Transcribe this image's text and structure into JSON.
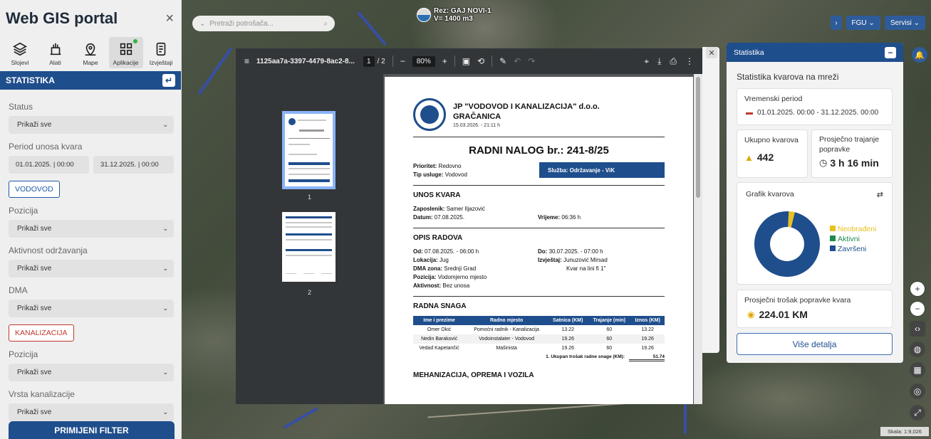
{
  "sidebar": {
    "title": "Web GIS portal",
    "close_icon": "×",
    "nav": [
      {
        "label": "Slojevi",
        "icon": "layers-icon"
      },
      {
        "label": "Alati",
        "icon": "tools-icon"
      },
      {
        "label": "Mape",
        "icon": "map-icon"
      },
      {
        "label": "Aplikacije",
        "icon": "apps-icon"
      },
      {
        "label": "Izvještaji",
        "icon": "reports-icon"
      }
    ],
    "section_title": "STATISTIKA",
    "filters": {
      "status_label": "Status",
      "status_value": "Prikaži sve",
      "period_label": "Period unosa kvara",
      "date_from": "01.01.2025. | 00:00",
      "date_to": "31.12.2025. | 00:00",
      "vodovod_tag": "VODOVOD",
      "pozicija_label": "Pozicija",
      "pozicija_value": "Prikaži sve",
      "aktivnost_label": "Aktivnost održavanja",
      "aktivnost_value": "Prikaži sve",
      "dma_label": "DMA",
      "dma_value": "Prikaži sve",
      "kanalizacija_tag": "KANALIZACIJA",
      "pozicija2_label": "Pozicija",
      "pozicija2_value": "Prikaži sve",
      "vrsta_label": "Vrsta kanalizacije",
      "vrsta_value": "Prikaži sve"
    },
    "apply_button": "PRIMIJENI FILTER"
  },
  "topbar": {
    "search_placeholder": "Pretraži potrošača...",
    "rez_line1": "Rez: GAJ NOVI-1",
    "rez_line2": "V= 1400 m3",
    "fgu_label": "FGU",
    "servisi_label": "Servisi"
  },
  "pdf": {
    "filename": "1125aa7a-3397-4479-8ac2-8...",
    "page_current": "1",
    "page_total": "/ 2",
    "zoom": "80%",
    "thumb1_num": "1",
    "thumb2_num": "2",
    "doc": {
      "company": "JP \"VODOVOD I KANALIZACIJA\" d.o.o.",
      "city": "GRAČANICA",
      "printed": "15.03.2026. - 21:11 h",
      "title": "RADNI NALOG br.: 241-8/25",
      "prioritet_label": "Prioritet:",
      "prioritet_value": "Redovno",
      "tip_label": "Tip usluge:",
      "tip_value": "Vodovod",
      "sluzba": "Služba: Održavanje - ViK",
      "unos_title": "UNOS KVARA",
      "zaposlenik_label": "Zaposlenik:",
      "zaposlenik_value": "Samer Iljazović",
      "datum_label": "Datum:",
      "datum_value": "07.08.2025.",
      "vrijeme_label": "Vrijeme:",
      "vrijeme_value": "06:36 h",
      "opis_title": "OPIS RADOVA",
      "od_label": "Od:",
      "od_value": "07.08.2025. - 06:00 h",
      "do_label": "Do:",
      "do_value": "30.07.2025. - 07:00 h",
      "lokacija_label": "Lokacija:",
      "lokacija_value": "Jug",
      "izvjestaj_label": "Izvještaj:",
      "izvjestaj_value": "Junuzović Mirsad",
      "izvjestaj_value2": "Kvar na lini fi 1\"",
      "dma_label": "DMA zona:",
      "dma_value": "Srednji Grad",
      "pozicija_label": "Pozicija:",
      "pozicija_value": "Vodomjerno mjesto",
      "aktivnost_label": "Aktivnost:",
      "aktivnost_value": "Bez unosa",
      "radna_title": "RADNA SNAGA",
      "table_headers": [
        "Ime i prezime",
        "Radno mjesto",
        "Satnica (KM)",
        "Trajanje (min)",
        "Iznos (KM)"
      ],
      "table_rows": [
        [
          "Omer Okić",
          "Pomoćni radnik - Kanalizacija",
          "13.22",
          "60",
          "13.22"
        ],
        [
          "Nedin Baraković",
          "Vodoinstalater - Vodovod",
          "19.26",
          "60",
          "19.26"
        ],
        [
          "Vedad Kapetančić",
          "Mašinista",
          "19.26",
          "60",
          "19.26"
        ]
      ],
      "total_label": "1. Ukupan trošak radne snage (KM):",
      "total_value": "51.74",
      "meh_title": "MEHANIZACIJA, OPREMA I VOZILA"
    }
  },
  "statistika": {
    "header": "Statistika",
    "subtitle": "Statistika kvarova na mreži",
    "period_title": "Vremenski period",
    "period_value": "01.01.2025. 00:00 - 31.12.2025. 00:00",
    "ukupno_title": "Ukupno kvarova",
    "ukupno_value": "442",
    "trajanje_title": "Prosječno trajanje popravke",
    "trajanje_value": "3 h 16 min",
    "grafik_title": "Grafik kvarova",
    "legend": [
      {
        "label": "Neobrađeni",
        "color": "#e8c020"
      },
      {
        "label": "Aktivni",
        "color": "#1e8a4c"
      },
      {
        "label": "Završeni",
        "color": "#1f4e8c"
      }
    ],
    "trosak_title": "Prosječni trošak popravke kvara",
    "trosak_value": "224.01 KM",
    "more_button": "Više detalja"
  },
  "chart_data": {
    "type": "pie",
    "categories": [
      "Neobrađeni",
      "Aktivni",
      "Završeni"
    ],
    "values": [
      3,
      0,
      97
    ],
    "legend_position": "right"
  },
  "map": {
    "scale": "Skala: 1:9,026"
  }
}
